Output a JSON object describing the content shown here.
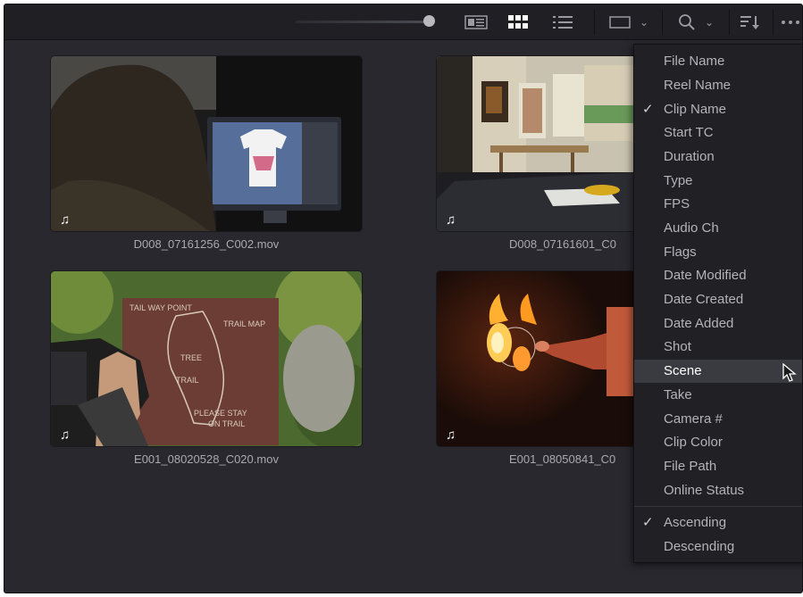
{
  "toolbar": {
    "icons": [
      "thumbnail-size-slider",
      "metadata-view-icon",
      "thumbnail-view-icon",
      "list-view-icon",
      "clip-filter-icon",
      "search-icon",
      "sort-menu-icon",
      "more-options-icon"
    ],
    "chevron": "⌄"
  },
  "clips": [
    {
      "name": "D008_07161256_C002.mov",
      "audio_icon": "music-note-icon"
    },
    {
      "name": "D008_07161601_C0",
      "audio_icon": "music-note-icon"
    },
    {
      "name": "E001_08020528_C020.mov",
      "audio_icon": "music-note-icon"
    },
    {
      "name": "E001_08050841_C0",
      "audio_icon": "music-note-icon"
    }
  ],
  "sort_menu": {
    "fields": [
      {
        "label": "File Name",
        "checked": false
      },
      {
        "label": "Reel Name",
        "checked": false
      },
      {
        "label": "Clip Name",
        "checked": true
      },
      {
        "label": "Start TC",
        "checked": false
      },
      {
        "label": "Duration",
        "checked": false
      },
      {
        "label": "Type",
        "checked": false
      },
      {
        "label": "FPS",
        "checked": false
      },
      {
        "label": "Audio Ch",
        "checked": false
      },
      {
        "label": "Flags",
        "checked": false
      },
      {
        "label": "Date Modified",
        "checked": false
      },
      {
        "label": "Date Created",
        "checked": false
      },
      {
        "label": "Date Added",
        "checked": false
      },
      {
        "label": "Shot",
        "checked": false
      },
      {
        "label": "Scene",
        "checked": false,
        "hovered": true
      },
      {
        "label": "Take",
        "checked": false
      },
      {
        "label": "Camera #",
        "checked": false
      },
      {
        "label": "Clip Color",
        "checked": false
      },
      {
        "label": "File Path",
        "checked": false
      },
      {
        "label": "Online Status",
        "checked": false
      }
    ],
    "order": [
      {
        "label": "Ascending",
        "checked": true
      },
      {
        "label": "Descending",
        "checked": false
      }
    ],
    "check_glyph": "✓"
  },
  "colors": {
    "panel_bg": "#28282e",
    "toolbar_bg": "#1f1f24",
    "menu_bg": "#202025",
    "menu_highlight": "#3a3a41",
    "text": "#b3b3b8"
  }
}
